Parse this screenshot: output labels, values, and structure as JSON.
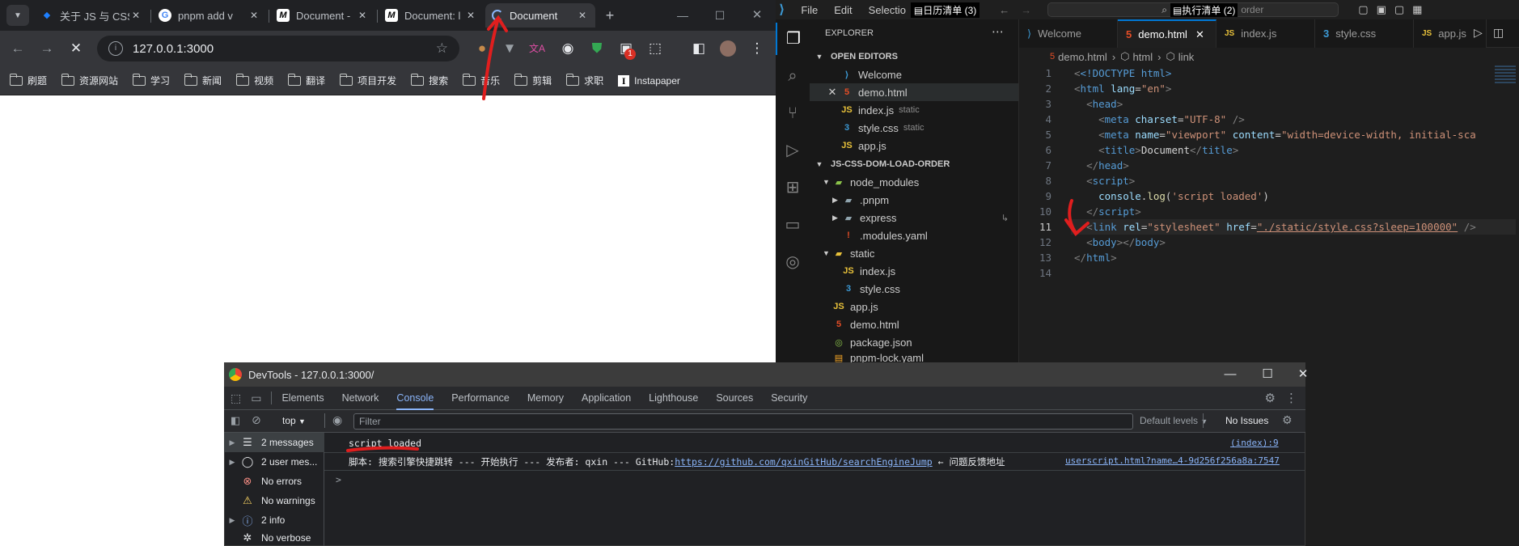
{
  "chrome": {
    "tabs": [
      {
        "title": "关于 JS 与 CSS",
        "favicon": "juejin-icon"
      },
      {
        "title": "pnpm add v",
        "favicon": "google-icon"
      },
      {
        "title": "Document -",
        "favicon": "m-icon"
      },
      {
        "title": "Document: l",
        "favicon": "m-icon"
      },
      {
        "title": "Document",
        "favicon": "loading-icon"
      }
    ],
    "new_tab": "+",
    "url": "127.0.0.1:3000",
    "extension_badge": "1",
    "bookmarks": [
      "刷题",
      "资源网站",
      "学习",
      "新闻",
      "视频",
      "翻译",
      "项目开发",
      "搜索",
      "音乐",
      "剪辑",
      "求职",
      "Instapaper"
    ]
  },
  "vscode": {
    "menus": [
      "File",
      "Edit",
      "Selectio"
    ],
    "overlay_left": "日历清单 (3)",
    "overlay_right": "执行清单 (2)",
    "search_text": "order",
    "explorer_title": "EXPLORER",
    "open_editors_title": "OPEN EDITORS",
    "open_editors": [
      {
        "name": "Welcome",
        "hint": "",
        "icon": "vscode-icon"
      },
      {
        "name": "demo.html",
        "hint": "",
        "icon": "html-icon"
      },
      {
        "name": "index.js",
        "hint": "static",
        "icon": "js-icon"
      },
      {
        "name": "style.css",
        "hint": "static",
        "icon": "css-icon"
      },
      {
        "name": "app.js",
        "hint": "",
        "icon": "js-icon"
      }
    ],
    "project_title": "JS-CSS-DOM-LOAD-ORDER",
    "tree": [
      {
        "name": "node_modules",
        "kind": "folder-open"
      },
      {
        "name": ".pnpm",
        "kind": "folder"
      },
      {
        "name": "express",
        "kind": "folder"
      },
      {
        "name": ".modules.yaml",
        "kind": "yaml"
      },
      {
        "name": "static",
        "kind": "folder-open"
      },
      {
        "name": "index.js",
        "kind": "js"
      },
      {
        "name": "style.css",
        "kind": "css"
      },
      {
        "name": "app.js",
        "kind": "js"
      },
      {
        "name": "demo.html",
        "kind": "html"
      },
      {
        "name": "package.json",
        "kind": "json"
      },
      {
        "name": "pnpm-lock.yaml",
        "kind": "yaml"
      }
    ],
    "editor_tabs": [
      "Welcome",
      "demo.html",
      "index.js",
      "style.css",
      "app.js"
    ],
    "breadcrumb": [
      "demo.html",
      "html",
      "link"
    ],
    "line_numbers": [
      "1",
      "2",
      "3",
      "4",
      "5",
      "6",
      "7",
      "8",
      "9",
      "10",
      "11",
      "12",
      "13",
      "14"
    ],
    "code": {
      "l1": "<!DOCTYPE html>",
      "l2_lang": "\"en\"",
      "l4_charset": "\"UTF-8\"",
      "l5_content": "\"width=device-width, initial-sca",
      "l6_title": "Document",
      "l9_log": "'script loaded'",
      "l11_href": "\"./static/style.css?sleep=100000\""
    }
  },
  "devtools": {
    "title": "DevTools - 127.0.0.1:3000/",
    "tabs": [
      "Elements",
      "Network",
      "Console",
      "Performance",
      "Memory",
      "Application",
      "Lighthouse",
      "Sources",
      "Security"
    ],
    "context": "top",
    "filter_placeholder": "Filter",
    "levels": "Default levels",
    "issues": "No Issues",
    "sidebar": [
      {
        "label": "2 messages",
        "icon": "list-icon"
      },
      {
        "label": "2 user mes...",
        "icon": "user-icon"
      },
      {
        "label": "No errors",
        "icon": "error-icon"
      },
      {
        "label": "No warnings",
        "icon": "warning-icon"
      },
      {
        "label": "2 info",
        "icon": "info-icon"
      },
      {
        "label": "No verbose",
        "icon": "bug-icon"
      }
    ],
    "console": [
      {
        "text": "script loaded",
        "source": "(index):9"
      },
      {
        "text_prefix": "脚本: 搜索引擎快捷跳转 --- 开始执行 --- 发布者: qxin --- GitHub:",
        "link": "https://github.com/qxinGitHub/searchEngineJump",
        "text_suffix": " ← 问题反馈地址",
        "source": "userscript.html?name…4-9d256f256a8a:7547"
      }
    ],
    "prompt": ">"
  },
  "colors": {
    "chrome_dark": "#202124",
    "vscode_bg": "#1e1e1e",
    "accent": "#0078d4",
    "annotation_red": "#e01e1e"
  }
}
